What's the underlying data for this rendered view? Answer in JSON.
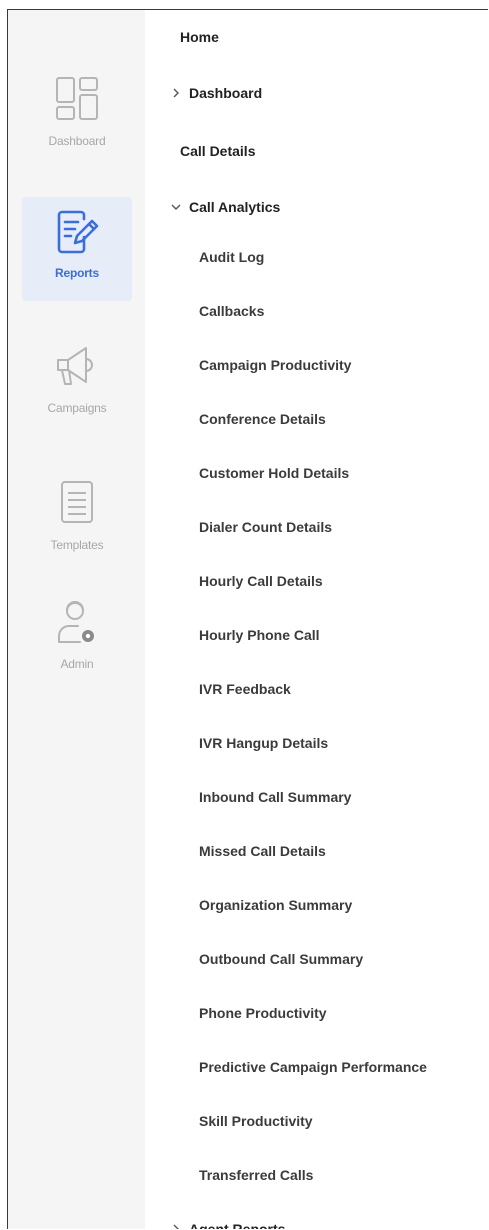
{
  "rail": {
    "items": [
      {
        "label": "Dashboard",
        "icon": "dashboard-grid-icon",
        "active": false
      },
      {
        "label": "Reports",
        "icon": "report-edit-icon",
        "active": true
      },
      {
        "label": "Campaigns",
        "icon": "megaphone-icon",
        "active": false
      },
      {
        "label": "Templates",
        "icon": "document-list-icon",
        "active": false
      },
      {
        "label": "Admin",
        "icon": "user-gear-icon",
        "active": false
      }
    ]
  },
  "menu": {
    "home": "Home",
    "dashboard": "Dashboard",
    "call_details": "Call Details",
    "call_analytics": "Call Analytics",
    "call_analytics_items": [
      "Audit Log",
      "Callbacks",
      "Campaign Productivity",
      "Conference Details",
      "Customer Hold Details",
      "Dialer Count Details",
      "Hourly Call Details",
      "Hourly Phone Call",
      "IVR Feedback",
      "IVR Hangup Details",
      "Inbound Call Summary",
      "Missed Call Details",
      "Organization Summary",
      "Outbound Call Summary",
      "Phone Productivity",
      "Predictive Campaign Performance",
      "Skill Productivity",
      "Transferred Calls"
    ],
    "next_group": "Agent Reports"
  },
  "colors": {
    "accent": "#3a6fd8",
    "rail_bg": "#f5f5f6",
    "active_bg": "#e6ecf8",
    "muted": "#a7a7aa"
  }
}
